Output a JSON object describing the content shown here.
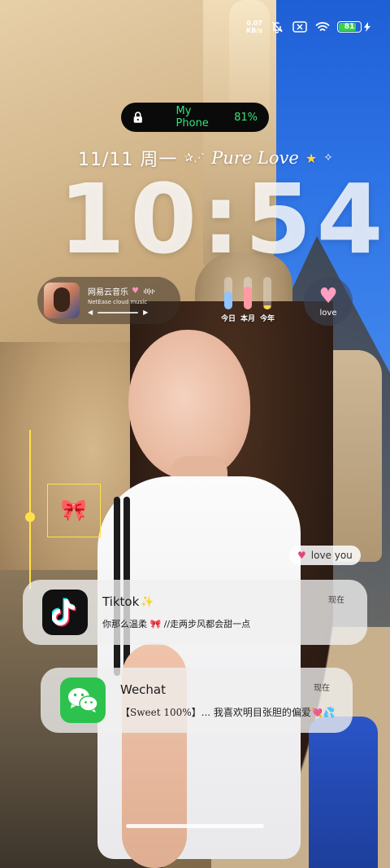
{
  "status_bar": {
    "net_speed_value": "0.07",
    "net_speed_unit": "KB/s",
    "battery_percent": "81",
    "battery_level": 0.81,
    "icons": [
      "bell-off-icon",
      "no-sim-icon",
      "wifi-icon",
      "battery-icon",
      "charging-icon"
    ]
  },
  "phone_pill": {
    "lock_icon": "lock-icon",
    "name": "My Phone",
    "battery": "81%",
    "color": "#36e27a"
  },
  "lock_screen": {
    "date": "11/11 周一",
    "tagline": "Pure Love",
    "time": "10:54"
  },
  "music_widget": {
    "title": "网易云音乐",
    "subtitle": "NetEase cloud music"
  },
  "progress_bars": [
    {
      "label": "今日",
      "fill": 0.55,
      "color": "#8fc4ff"
    },
    {
      "label": "本月",
      "fill": 0.7,
      "color": "#ff9aa2"
    },
    {
      "label": "今年",
      "fill": 0.12,
      "color": "#ffd54a"
    }
  ],
  "love_widget": {
    "label": "love"
  },
  "love_tag": {
    "text": "love you"
  },
  "notifications": [
    {
      "app": "Tiktok",
      "time": "现在",
      "message": "你那么温柔 🎀 //走两步风都会甜一点"
    },
    {
      "app": "Wechat",
      "time": "现在",
      "message": "【Sweet 100%】... 我喜欢明目张胆的偏爱💘💦"
    }
  ]
}
